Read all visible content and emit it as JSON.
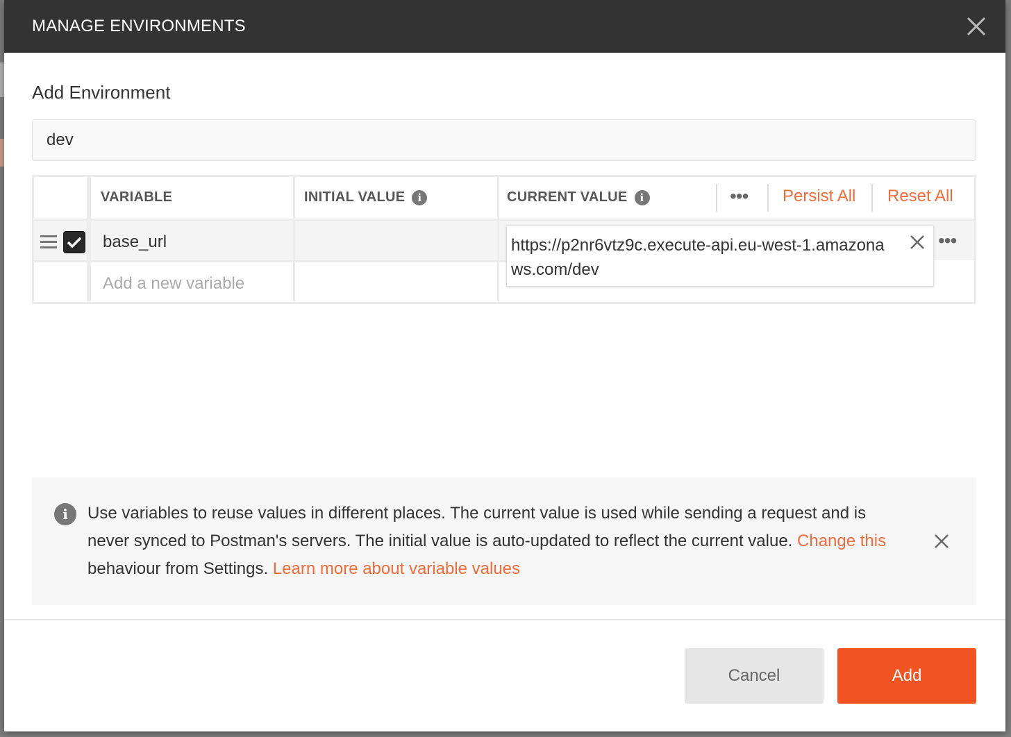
{
  "modal": {
    "title": "MANAGE ENVIRONMENTS",
    "section_title": "Add Environment",
    "env_name_value": "dev"
  },
  "table": {
    "headers": {
      "variable": "VARIABLE",
      "initial_value": "INITIAL VALUE",
      "current_value": "CURRENT VALUE",
      "more": "•••",
      "persist_all": "Persist All",
      "reset_all": "Reset All"
    },
    "rows": [
      {
        "enabled": true,
        "variable": "base_url",
        "initial_value": "",
        "current_value": "https://p2nr6vtz9c.execute-api.eu-west-1.amazonaws.com/dev",
        "more": "•••"
      }
    ],
    "new_variable_placeholder": "Add a new variable"
  },
  "banner": {
    "text_1": "Use variables to reuse values in different places. The current value is used while sending a request and is never synced to Postman's servers. The initial value is auto-updated to reflect the current value. ",
    "link_change": "Change this",
    "text_2": " behaviour from Settings. ",
    "link_learn": "Learn more about variable values"
  },
  "footer": {
    "cancel_label": "Cancel",
    "add_label": "Add"
  },
  "colors": {
    "accent": "#f05423",
    "link": "#f26b3a",
    "header_bg": "#333333"
  }
}
